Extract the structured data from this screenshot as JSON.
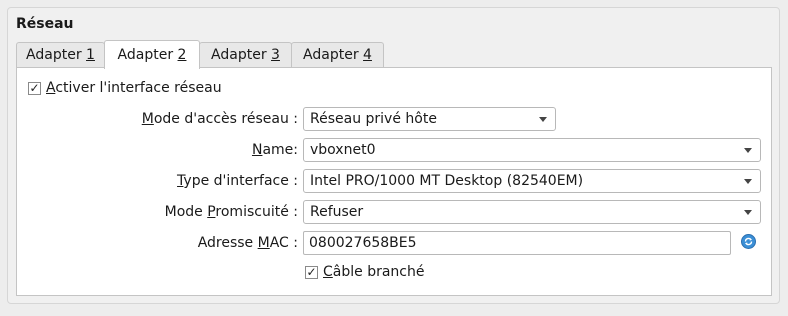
{
  "section": {
    "title": "Réseau"
  },
  "tabs": [
    {
      "pre": "Adapter ",
      "key": "1"
    },
    {
      "pre": "Adapter ",
      "key": "2"
    },
    {
      "pre": "Adapter ",
      "key": "3"
    },
    {
      "pre": "Adapter ",
      "key": "4"
    }
  ],
  "active_tab_index": 1,
  "enable": {
    "label_key": "A",
    "label_rest": "ctiver l'interface réseau",
    "checked": true
  },
  "attached": {
    "pre": "",
    "key": "M",
    "rest": "ode d'accès réseau :",
    "value": "Réseau privé hôte"
  },
  "name": {
    "pre": "",
    "key": "N",
    "rest": "ame:",
    "value": "vboxnet0"
  },
  "adapter_type": {
    "pre": "",
    "key": "T",
    "rest": "ype d'interface :",
    "value": "Intel PRO/1000 MT Desktop (82540EM)"
  },
  "promiscuous": {
    "pre": "Mode ",
    "key": "P",
    "rest": "romiscuité :",
    "value": "Refuser"
  },
  "mac": {
    "pre": "Adresse ",
    "key": "M",
    "rest": "AC :",
    "value": "080027658BE5",
    "refresh_icon": "refresh-mac-icon"
  },
  "cable": {
    "label_key": "C",
    "label_rest": "âble branché",
    "checked": true
  },
  "colors": {
    "accent": "#3b8fd6"
  }
}
